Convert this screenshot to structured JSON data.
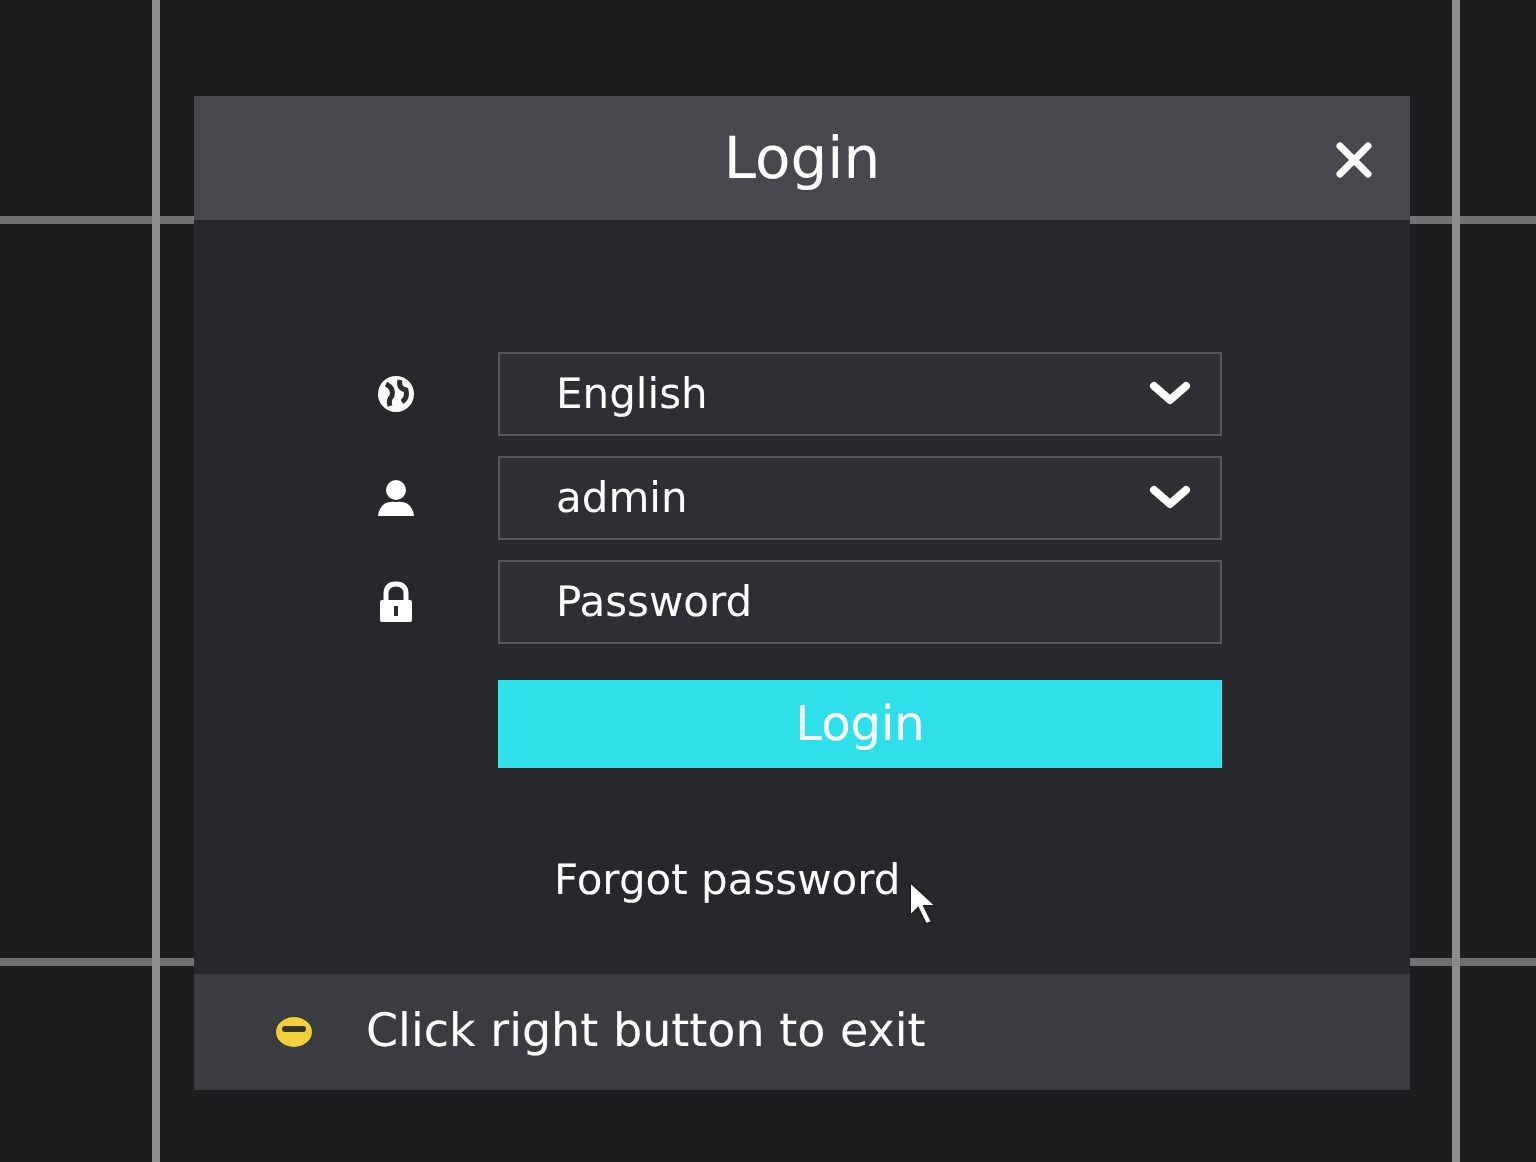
{
  "dialog": {
    "title": "Login"
  },
  "fields": [
    {
      "kind": "language",
      "value": "English"
    },
    {
      "kind": "user",
      "value": "admin"
    },
    {
      "kind": "password",
      "placeholder": "Password"
    }
  ],
  "login_button": "Login",
  "forgot_link": "Forgot password",
  "status_bar": {
    "text": "Click right button to exit"
  }
}
